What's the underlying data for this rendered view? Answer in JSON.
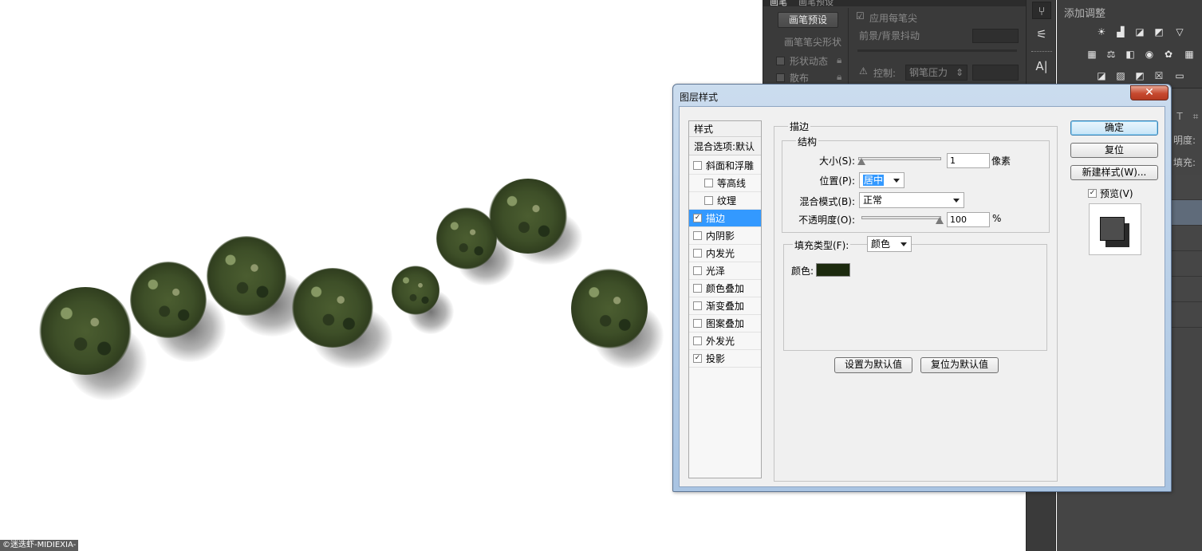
{
  "watermark": "©迷迭虾-MIDIEXIA-",
  "brush_panel": {
    "tabs": [
      "画笔",
      "画笔预设"
    ],
    "preset_button": "画笔预设",
    "apply_each_tip": "应用每笔尖",
    "fg_bg_jitter": "前景/背景抖动",
    "tip_shape": "画笔笔尖形状",
    "shape_dynamics": "形状动态",
    "scatter": "散布",
    "control_label": "控制:",
    "control_value": "钢笔压力"
  },
  "adjust_panel": {
    "title": "添加调整",
    "opacity_label": "明度:",
    "fill_label": "填充:"
  },
  "dialog": {
    "title": "图层样式",
    "close": "✕",
    "styles_header": "样式",
    "blend_options": "混合选项:默认",
    "effects": [
      {
        "label": "斜面和浮雕",
        "checked": false,
        "indent": false,
        "selected": false
      },
      {
        "label": "等高线",
        "checked": false,
        "indent": true,
        "selected": false
      },
      {
        "label": "纹理",
        "checked": false,
        "indent": true,
        "selected": false
      },
      {
        "label": "描边",
        "checked": true,
        "indent": false,
        "selected": true
      },
      {
        "label": "内阴影",
        "checked": false,
        "indent": false,
        "selected": false
      },
      {
        "label": "内发光",
        "checked": false,
        "indent": false,
        "selected": false
      },
      {
        "label": "光泽",
        "checked": false,
        "indent": false,
        "selected": false
      },
      {
        "label": "颜色叠加",
        "checked": false,
        "indent": false,
        "selected": false
      },
      {
        "label": "渐变叠加",
        "checked": false,
        "indent": false,
        "selected": false
      },
      {
        "label": "图案叠加",
        "checked": false,
        "indent": false,
        "selected": false
      },
      {
        "label": "外发光",
        "checked": false,
        "indent": false,
        "selected": false
      },
      {
        "label": "投影",
        "checked": true,
        "indent": false,
        "selected": false
      }
    ],
    "stroke": {
      "group_title": "描边",
      "structure_title": "结构",
      "size_label": "大小(S):",
      "size_value": "1",
      "size_unit": "像素",
      "position_label": "位置(P):",
      "position_value": "居中",
      "blend_mode_label": "混合模式(B):",
      "blend_mode_value": "正常",
      "opacity_label": "不透明度(O):",
      "opacity_value": "100",
      "opacity_unit": "%",
      "fill_type_label": "填充类型(F):",
      "fill_type_value": "颜色",
      "color_label": "颜色:",
      "color_value": "#1c2a0e",
      "set_default": "设置为默认值",
      "reset_default": "复位为默认值"
    },
    "buttons": {
      "ok": "确定",
      "reset": "复位",
      "new_style": "新建样式(W)...",
      "preview_label": "预览(V)",
      "preview_checked": true
    }
  }
}
